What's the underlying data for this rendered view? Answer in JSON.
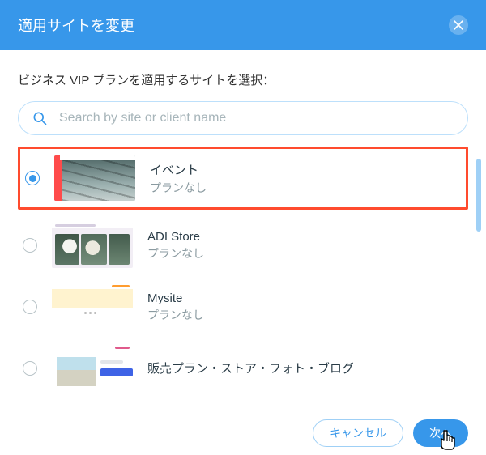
{
  "header": {
    "title": "適用サイトを変更"
  },
  "subtitle": "ビジネス VIP プランを適用するサイトを選択：",
  "search": {
    "placeholder": "Search by site or client name"
  },
  "sites": [
    {
      "title": "イベント",
      "plan": "プランなし",
      "selected": true
    },
    {
      "title": "ADI Store",
      "plan": "プランなし",
      "selected": false
    },
    {
      "title": "Mysite",
      "plan": "プランなし",
      "selected": false
    },
    {
      "title": "販売プラン・ストア・フォト・ブログ",
      "plan": "",
      "selected": false
    }
  ],
  "footer": {
    "cancel": "キャンセル",
    "next": "次へ"
  }
}
